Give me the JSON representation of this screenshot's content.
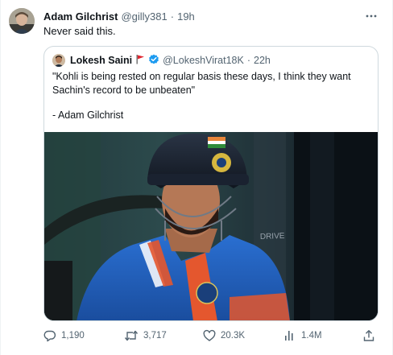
{
  "tweet": {
    "author_name": "Adam Gilchrist",
    "handle": "@gilly381",
    "separator": "·",
    "time": "19h",
    "text": "Never said this."
  },
  "quote": {
    "author_name": "Lokesh Saini",
    "flag_icon": "red-flag-emoji",
    "verified_icon": "verified-badge-icon",
    "handle": "@LokeshVirat18K",
    "separator": "·",
    "time": "22h",
    "text": "\"Kohli is being rested on regular basis these days, I think they want Sachin's record to be unbeaten\"",
    "signature": "- Adam Gilchrist",
    "media_overlay": "DRIVE"
  },
  "actions": {
    "replies": "1,190",
    "reposts": "3,717",
    "likes": "20.3K",
    "views": "1.4M"
  },
  "colors": {
    "text": "#0f1419",
    "muted": "#536471",
    "border": "#cfd9de",
    "verified": "#1d9bf0",
    "jersey_blue": "#1f5fbf",
    "jersey_orange": "#e4572e",
    "helmet": "#1b2230"
  }
}
